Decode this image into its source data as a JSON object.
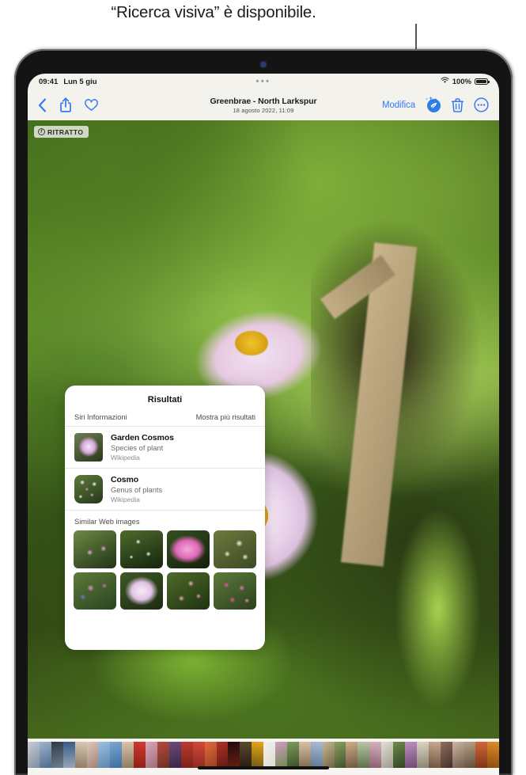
{
  "callout": {
    "text": "“Ricerca visiva” è disponibile."
  },
  "device": {
    "camera_icon": "front-camera-dot"
  },
  "status_bar": {
    "time": "09:41",
    "date": "Lun 5 giu",
    "multitask_indicator": "•••",
    "wifi_icon": "wifi-icon",
    "battery_percent": "100%",
    "battery_icon": "battery-full-icon"
  },
  "toolbar": {
    "back_icon": "chevron-left-icon",
    "share_icon": "share-up-arrow-icon",
    "favorite_icon": "heart-icon",
    "title": "Greenbrae - North Larkspur",
    "subtitle": "18 agosto 2022,  11:09",
    "edit_label": "Modifica",
    "visual_lookup_icon": "visual-look-up-sparkle-icon",
    "delete_icon": "trash-icon",
    "more_icon": "more-ellipsis-circle-icon"
  },
  "photo": {
    "badge_label": "RITRATTO",
    "badge_icon": "aperture-f-icon",
    "description": "Primo piano di fiori di cosmea rosa chiaro in un orto"
  },
  "results_panel": {
    "title": "Risultati",
    "siri_link": "Siri Informazioni",
    "more_link": "Mostra più risultati",
    "entries": [
      {
        "name": "Garden Cosmos",
        "description": "Species of plant",
        "source": "Wikipedia",
        "thumb_icon": "garden-cosmos-thumbnail"
      },
      {
        "name": "Cosmo",
        "description": "Genus of plants",
        "source": "Wikipedia",
        "thumb_icon": "cosmo-genus-thumbnail"
      }
    ],
    "similar_title": "Similar Web images",
    "similar_images": [
      {
        "alt": "cosmea rosa su prato verde"
      },
      {
        "alt": "fiori bianchi di cosmea"
      },
      {
        "alt": "cosmea rosa intenso in primo piano"
      },
      {
        "alt": "cosmee bianche e crema"
      },
      {
        "alt": "cosmea rosa e fiori blu"
      },
      {
        "alt": "cosmea rosa chiaro in primo piano"
      },
      {
        "alt": "cosmee rosa in giardino"
      },
      {
        "alt": "cespuglio di cosmee fucsia"
      }
    ]
  },
  "filmstrip": {
    "label": "Striscia miniature foto",
    "thumbnails": [
      {
        "c1": "#c7cdd6",
        "c2": "#7e8da0"
      },
      {
        "c1": "#9fb3cc",
        "c2": "#4a6a8d"
      },
      {
        "c1": "#2f3b46",
        "c2": "#6d7f8e"
      },
      {
        "c1": "#3b5b86",
        "c2": "#97a7b8"
      },
      {
        "c1": "#d9c8b4",
        "c2": "#8c7a63"
      },
      {
        "c1": "#e2c9ba",
        "c2": "#a07f74"
      },
      {
        "c1": "#9fc0e0",
        "c2": "#5b84ad"
      },
      {
        "c1": "#7aa6d2",
        "c2": "#3e6e9e"
      },
      {
        "c1": "#d7c6ad",
        "c2": "#8e7a5f"
      },
      {
        "c1": "#cf3b2f",
        "c2": "#8e2018"
      },
      {
        "c1": "#d8a9b5",
        "c2": "#a06a7b"
      },
      {
        "c1": "#b64b3e",
        "c2": "#6d2f26"
      },
      {
        "c1": "#6c4b7c",
        "c2": "#3a2546"
      },
      {
        "c1": "#c03a2e",
        "c2": "#7a211a"
      },
      {
        "c1": "#d6483a",
        "c2": "#8c2a20"
      },
      {
        "c1": "#e06a3e",
        "c2": "#97401f"
      },
      {
        "c1": "#b13226",
        "c2": "#5f1a13"
      },
      {
        "c1": "#210b0b",
        "c2": "#6a1d12"
      },
      {
        "c1": "#5a4a2f",
        "c2": "#261d10"
      },
      {
        "c1": "#e8a517",
        "c2": "#6f5a12"
      },
      {
        "c1": "#f2f1ec",
        "c2": "#dedbd2"
      },
      {
        "c1": "#cf9fc2",
        "c2": "#6c8a4e"
      },
      {
        "c1": "#7f9a5c",
        "c2": "#39512a"
      },
      {
        "c1": "#d9c2a4",
        "c2": "#7d6a50"
      },
      {
        "c1": "#a9bcd6",
        "c2": "#5c7693"
      },
      {
        "c1": "#c8b894",
        "c2": "#6f6243"
      },
      {
        "c1": "#8aa05f",
        "c2": "#3f522c"
      },
      {
        "c1": "#cfae8a",
        "c2": "#6d5740"
      },
      {
        "c1": "#b9c7a6",
        "c2": "#5d6e4c"
      },
      {
        "c1": "#d6b3bf",
        "c2": "#8a5f6d"
      },
      {
        "c1": "#e2e0d6",
        "c2": "#9d9a8c"
      },
      {
        "c1": "#6f8a4e",
        "c2": "#2f4422"
      },
      {
        "c1": "#c08fbe",
        "c2": "#6b4a73"
      },
      {
        "c1": "#d9d4c2",
        "c2": "#8b8474"
      },
      {
        "c1": "#caa98e",
        "c2": "#6d533f"
      },
      {
        "c1": "#8f6f5e",
        "c2": "#43302a"
      },
      {
        "c1": "#cdb7a2",
        "c2": "#6f5c4c"
      },
      {
        "c1": "#b9a287",
        "c2": "#5e4e3c"
      },
      {
        "c1": "#d2663a",
        "c2": "#7e3418"
      },
      {
        "c1": "#e08a2a",
        "c2": "#8a4e10"
      }
    ],
    "home_indicator": "home-indicator"
  }
}
